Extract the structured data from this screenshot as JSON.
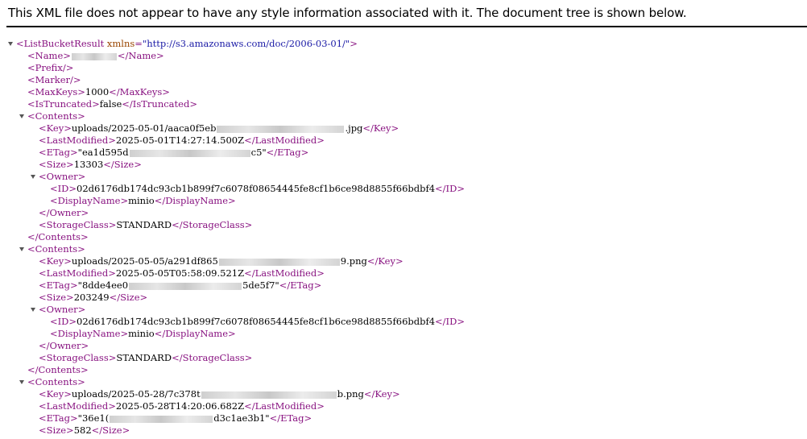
{
  "header": {
    "text": "This XML file does not appear to have any style information associated with it. The document tree is shown below."
  },
  "xml": {
    "root_open": "<ListBucketResult",
    "xmlns_attr": "xmlns",
    "xmlns_value": "\"http://s3.amazonaws.com/doc/2006-03-01/\"",
    "root_open_end": ">",
    "name_open": "<Name>",
    "name_close": "</Name>",
    "prefix": "<Prefix/>",
    "marker": "<Marker/>",
    "maxkeys_open": "<MaxKeys>",
    "maxkeys_value": "1000",
    "maxkeys_close": "</MaxKeys>",
    "istruncated_open": "<IsTruncated>",
    "istruncated_value": "false",
    "istruncated_close": "</IsTruncated>",
    "contents_open": "<Contents>",
    "contents_close": "</Contents>",
    "key_open": "<Key>",
    "key_close": "</Key>",
    "lastmodified_open": "<LastModified>",
    "lastmodified_close": "</LastModified>",
    "etag_open": "<ETag>",
    "etag_close": "</ETag>",
    "size_open": "<Size>",
    "size_close": "</Size>",
    "owner_open": "<Owner>",
    "owner_close": "</Owner>",
    "id_open": "<ID>",
    "id_close": "</ID>",
    "displayname_open": "<DisplayName>",
    "displayname_close": "</DisplayName>",
    "storageclass_open": "<StorageClass>",
    "storageclass_close": "</StorageClass>",
    "contents": [
      {
        "key_start": "uploads/2025-05-01/aaca0f5eb",
        "key_end": ".jpg",
        "last_modified": "2025-05-01T14:27:14.500Z",
        "etag_start": "\"ea1d595d",
        "etag_end": "c5\"",
        "size": "13303",
        "owner_id": "02d6176db174dc93cb1b899f7c6078f08654445fe8cf1b6ce98d8855f66bdbf4",
        "display_name": "minio",
        "storage_class": "STANDARD"
      },
      {
        "key_start": "uploads/2025-05-05/a291df865",
        "key_end": "9.png",
        "last_modified": "2025-05-05T05:58:09.521Z",
        "etag_start": "\"8dde4ee0",
        "etag_end": "5de5f7\"",
        "size": "203249",
        "owner_id": "02d6176db174dc93cb1b899f7c6078f08654445fe8cf1b6ce98d8855f66bdbf4",
        "display_name": "minio",
        "storage_class": "STANDARD"
      },
      {
        "key_start": "uploads/2025-05-28/7c378t",
        "key_end": "b.png",
        "last_modified": "2025-05-28T14:20:06.682Z",
        "etag_start": "\"36e1(",
        "etag_end": "d3c1ae3b1\"",
        "size": "582"
      }
    ],
    "colors": {
      "tag": "#881280",
      "attribute_name": "#994500",
      "attribute_value": "#1a1aa6",
      "text": "#000000"
    }
  }
}
